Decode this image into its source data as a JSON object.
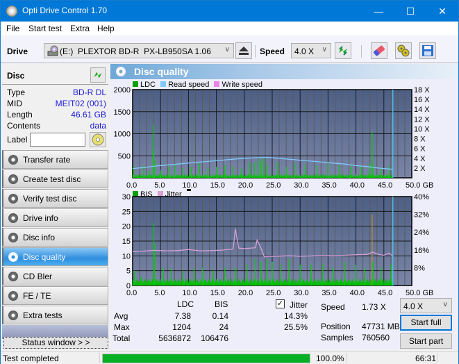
{
  "window": {
    "title": "Opti Drive Control 1.70",
    "controls": {
      "minimize": "—",
      "maximize": "☐",
      "close": "✕"
    }
  },
  "menu": [
    "File",
    "Start test",
    "Extra",
    "Help"
  ],
  "menu_underline": [
    "F",
    "S",
    "x",
    "H"
  ],
  "toolbar": {
    "drive_label": "Drive",
    "drive_value": "(E:)  PLEXTOR BD-R  PX-LB950SA 1.06",
    "speed_label": "Speed",
    "speed_value": "4.0 X",
    "icons": [
      "eject-icon",
      "refresh-icon",
      "erase-icon",
      "settings-icon",
      "save-icon"
    ]
  },
  "disc": {
    "header": "Disc",
    "rows": [
      {
        "key": "Type",
        "value": "BD-R DL"
      },
      {
        "key": "MID",
        "value": "MEIT02 (001)"
      },
      {
        "key": "Length",
        "value": "46.61 GB"
      },
      {
        "key": "Contents",
        "value": "data"
      }
    ],
    "label_key": "Label",
    "label_value": ""
  },
  "nav": [
    {
      "label": "Transfer rate",
      "active": false
    },
    {
      "label": "Create test disc",
      "active": false
    },
    {
      "label": "Verify test disc",
      "active": false
    },
    {
      "label": "Drive info",
      "active": false
    },
    {
      "label": "Disc info",
      "active": false
    },
    {
      "label": "Disc quality",
      "active": true
    },
    {
      "label": "CD Bler",
      "active": false
    },
    {
      "label": "FE / TE",
      "active": false
    },
    {
      "label": "Extra tests",
      "active": false
    }
  ],
  "status_window_button": "Status window > >",
  "main": {
    "title": "Disc quality"
  },
  "chart_data": [
    {
      "type": "bar",
      "title": "",
      "legend": [
        {
          "name": "LDC",
          "color": "#00a000"
        },
        {
          "name": "Read speed",
          "color": "#7fc8f8"
        },
        {
          "name": "Write speed",
          "color": "#f080e8"
        }
      ],
      "legend_position": "top-left",
      "xlabel": "GB",
      "x_ticks": [
        "0.0",
        "5.0",
        "10.0",
        "15.0",
        "20.0",
        "25.0",
        "30.0",
        "35.0",
        "40.0",
        "45.0",
        "50.0 GB"
      ],
      "xlim": [
        0,
        50
      ],
      "y_ticks": [
        "500",
        "1000",
        "1500",
        "2000"
      ],
      "ylim": [
        0,
        2000
      ],
      "y2_ticks": [
        "2 X",
        "4 X",
        "6 X",
        "8 X",
        "10 X",
        "12 X",
        "14 X",
        "16 X",
        "18 X"
      ],
      "y2lim": [
        0,
        18
      ],
      "grid": true,
      "end_marker_x": 46.61,
      "series": [
        {
          "name": "LDC",
          "x": [
            0.2,
            1.0,
            2.0,
            3.0,
            3.7,
            3.8,
            3.9,
            5.0,
            6.5,
            7.5,
            9.0,
            10.5,
            12.0,
            13.5,
            15.0,
            16.5,
            18.0,
            19.5,
            21.0,
            21.8,
            22.5,
            23.0,
            23.5,
            24.0,
            26.0,
            27.5,
            29.0,
            31.0,
            33.0,
            35.0,
            37.0,
            39.0,
            41.0,
            42.5,
            42.9,
            43.0,
            44.5,
            46.0
          ],
          "values": [
            250,
            60,
            280,
            160,
            620,
            1204,
            400,
            180,
            260,
            300,
            220,
            250,
            330,
            230,
            250,
            280,
            260,
            220,
            340,
            350,
            420,
            380,
            450,
            300,
            360,
            250,
            330,
            300,
            280,
            340,
            300,
            260,
            280,
            320,
            1050,
            300,
            200,
            280
          ]
        },
        {
          "name": "Read speed",
          "x": [
            0,
            2,
            4,
            6,
            8,
            10,
            12,
            14,
            16,
            18,
            20,
            22,
            24,
            26,
            28,
            30,
            32,
            34,
            36,
            38,
            40,
            42,
            44,
            46,
            46.6
          ],
          "values": [
            1.9,
            2.1,
            2.4,
            2.6,
            2.8,
            3.0,
            3.2,
            3.4,
            3.6,
            3.8,
            4.0,
            4.1,
            4.2,
            4.0,
            3.8,
            3.6,
            3.4,
            3.2,
            3.0,
            2.8,
            2.5,
            2.3,
            2.0,
            1.8,
            1.73
          ]
        }
      ]
    },
    {
      "type": "bar",
      "title": "",
      "legend": [
        {
          "name": "BIS",
          "color": "#00a000"
        },
        {
          "name": "Jitter",
          "color": "#d8a0d8"
        }
      ],
      "legend_position": "top-left",
      "xlabel": "GB",
      "x_ticks": [
        "0.0",
        "5.0",
        "10.0",
        "15.0",
        "20.0",
        "25.0",
        "30.0",
        "35.0",
        "40.0",
        "45.0",
        "50.0 GB"
      ],
      "xlim": [
        0,
        50
      ],
      "y_ticks": [
        "5",
        "10",
        "15",
        "20",
        "25",
        "30"
      ],
      "ylim": [
        0,
        30
      ],
      "y2_ticks": [
        "8%",
        "16%",
        "24%",
        "32%",
        "40%"
      ],
      "y2lim": [
        0,
        40
      ],
      "grid": true,
      "end_marker_x": 46.61,
      "series": [
        {
          "name": "BIS",
          "x": [
            0.3,
            1.5,
            3.8,
            3.9,
            5.5,
            7.0,
            9.0,
            11.0,
            12.5,
            14.5,
            16.5,
            18.5,
            20.5,
            22.0,
            23.0,
            24.0,
            25.0,
            26.5,
            28.0,
            30.0,
            32.0,
            34.0,
            36.0,
            38.0,
            40.0,
            41.5,
            42.9,
            43.0,
            44.5,
            46.3
          ],
          "values": [
            5,
            3,
            21,
            14,
            6,
            6,
            5,
            6,
            6,
            5,
            6,
            6,
            7,
            9,
            8,
            9,
            8,
            7,
            9,
            7,
            7,
            7,
            6,
            8,
            7,
            6,
            24,
            8,
            6,
            7
          ]
        },
        {
          "name": "Jitter",
          "x": [
            0,
            2,
            4,
            6,
            8,
            10,
            12,
            14,
            16,
            18,
            18.4,
            19,
            20,
            22,
            22.3,
            23,
            23.6,
            24,
            26,
            28,
            30,
            32,
            34,
            36,
            38,
            40,
            42,
            43,
            44,
            45,
            46,
            46.6
          ],
          "values": [
            15.2,
            15.5,
            15.8,
            15.6,
            15.7,
            16.2,
            15.6,
            15.7,
            15.9,
            16.4,
            25.5,
            16.8,
            16.6,
            17.0,
            20.5,
            16.8,
            12.8,
            13.0,
            13.2,
            13.4,
            13.2,
            13.3,
            13.6,
            13.4,
            13.6,
            13.8,
            14.0,
            15.0,
            14.0,
            13.6,
            14.6,
            13.0
          ]
        }
      ]
    }
  ],
  "stats": {
    "col_headers": [
      "LDC",
      "BIS"
    ],
    "rows": [
      {
        "label": "Avg",
        "ldc": "7.38",
        "bis": "0.14",
        "jitter": "14.3%"
      },
      {
        "label": "Max",
        "ldc": "1204",
        "bis": "24",
        "jitter": "25.5%"
      },
      {
        "label": "Total",
        "ldc": "5636872",
        "bis": "106476",
        "jitter": ""
      }
    ],
    "jitter_label": "Jitter",
    "jitter_checked": true,
    "speed_label": "Speed",
    "speed_value": "1.73 X",
    "position_label": "Position",
    "position_value": "47731 MB",
    "samples_label": "Samples",
    "samples_value": "760560",
    "speed_select": "4.0 X",
    "start_full": "Start full",
    "start_part": "Start part"
  },
  "statusbar": {
    "text": "Test completed",
    "progress": 100.0,
    "progress_text": "100.0%",
    "elapsed": "66:31"
  }
}
